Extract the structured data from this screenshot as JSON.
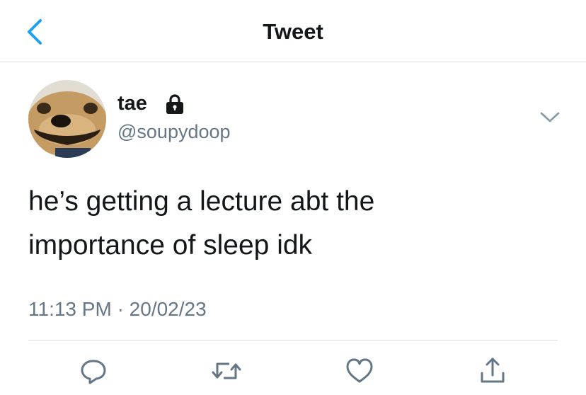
{
  "header": {
    "title": "Tweet",
    "back_icon": "chevron-left-icon"
  },
  "tweet": {
    "author": {
      "display_name": "tae",
      "handle": "@soupydoop",
      "protected_icon": "lock-icon",
      "avatar": "avatar"
    },
    "text_lines": [
      "he’s getting a lecture abt the",
      "importance of sleep idk"
    ],
    "time": "11:13 PM",
    "separator": "·",
    "date": "20/02/23",
    "more_icon": "chevron-down-icon"
  },
  "actions": [
    {
      "name": "reply",
      "icon": "reply-icon"
    },
    {
      "name": "retweet",
      "icon": "retweet-icon"
    },
    {
      "name": "like",
      "icon": "heart-icon"
    },
    {
      "name": "share",
      "icon": "share-icon"
    }
  ],
  "colors": {
    "accent": "#1da1f2",
    "text_primary": "#14171a",
    "text_secondary": "#657786",
    "divider": "#d9dde0"
  }
}
